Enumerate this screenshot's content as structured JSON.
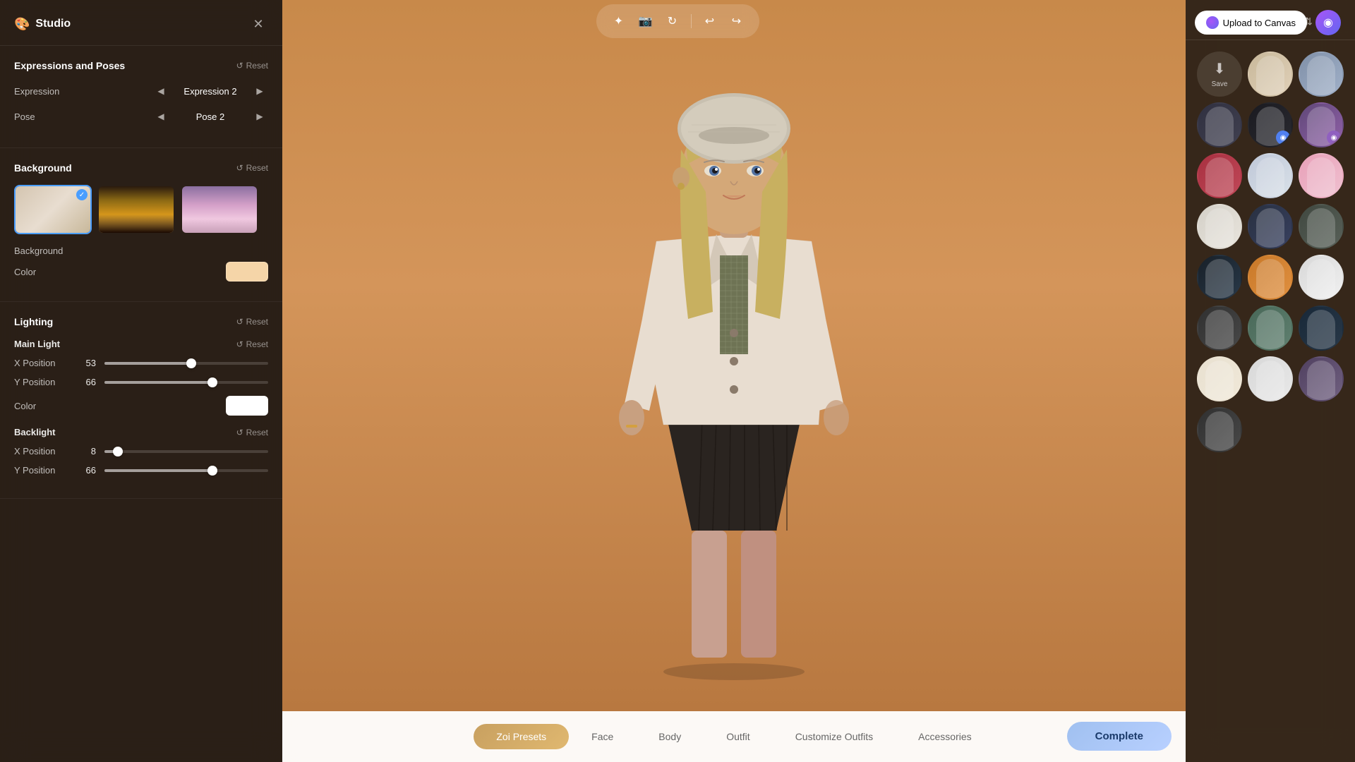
{
  "app": {
    "title": "Studio"
  },
  "toolbar": {
    "upload_label": "Upload to Canvas",
    "tools": [
      {
        "name": "magic-tool",
        "icon": "✦"
      },
      {
        "name": "camera-tool",
        "icon": "📷"
      },
      {
        "name": "refresh-tool",
        "icon": "↻"
      },
      {
        "name": "undo-tool",
        "icon": "↩"
      },
      {
        "name": "redo-tool",
        "icon": "↪"
      }
    ]
  },
  "left_panel": {
    "expressions_section": {
      "title": "Expressions and Poses",
      "reset_label": "Reset",
      "expression_label": "Expression",
      "expression_value": "Expression 2",
      "pose_label": "Pose",
      "pose_value": "Pose 2"
    },
    "background_section": {
      "title": "Background",
      "reset_label": "Reset",
      "color_label": "Color",
      "bg_label": "Background"
    },
    "lighting_section": {
      "title": "Lighting",
      "reset_label": "Reset",
      "main_light": {
        "title": "Main Light",
        "reset_label": "Reset",
        "x_label": "X Position",
        "x_value": 53,
        "x_percent": 53,
        "y_label": "Y Position",
        "y_value": 66,
        "y_percent": 66,
        "color_label": "Color"
      },
      "backlight": {
        "title": "Backlight",
        "reset_label": "Reset",
        "x_label": "X Position",
        "x_value": 8,
        "x_percent": 8,
        "y_label": "Y Position",
        "y_value": 66,
        "y_percent": 66
      }
    }
  },
  "right_panel": {
    "title": "Zoi Presets",
    "save_label": "Save",
    "presets": [
      {
        "id": 1,
        "class": "p1"
      },
      {
        "id": 2,
        "class": "p2"
      },
      {
        "id": 3,
        "class": "p3"
      },
      {
        "id": 4,
        "class": "p4",
        "badge": "blue"
      },
      {
        "id": 5,
        "class": "p5"
      },
      {
        "id": 6,
        "class": "p6",
        "badge": "purple"
      },
      {
        "id": 7,
        "class": "p7"
      },
      {
        "id": 8,
        "class": "p8"
      },
      {
        "id": 9,
        "class": "p9"
      },
      {
        "id": 10,
        "class": "p10"
      },
      {
        "id": 11,
        "class": "p11"
      },
      {
        "id": 12,
        "class": "p12"
      },
      {
        "id": 13,
        "class": "p13"
      },
      {
        "id": 14,
        "class": "p14"
      },
      {
        "id": 15,
        "class": "p15"
      },
      {
        "id": 16,
        "class": "p16"
      },
      {
        "id": 17,
        "class": "p17"
      },
      {
        "id": 18,
        "class": "p18"
      },
      {
        "id": 19,
        "class": "p19"
      },
      {
        "id": 20,
        "class": "p20"
      },
      {
        "id": 21,
        "class": "p21"
      }
    ]
  },
  "bottom_nav": {
    "tabs": [
      {
        "id": "zoi-presets",
        "label": "Zoi Presets",
        "active": true
      },
      {
        "id": "face",
        "label": "Face",
        "active": false
      },
      {
        "id": "body",
        "label": "Body",
        "active": false
      },
      {
        "id": "outfit",
        "label": "Outfit",
        "active": false
      },
      {
        "id": "customize-outfits",
        "label": "Customize Outfits",
        "active": false
      },
      {
        "id": "accessories",
        "label": "Accessories",
        "active": false
      }
    ],
    "complete_label": "Complete"
  }
}
